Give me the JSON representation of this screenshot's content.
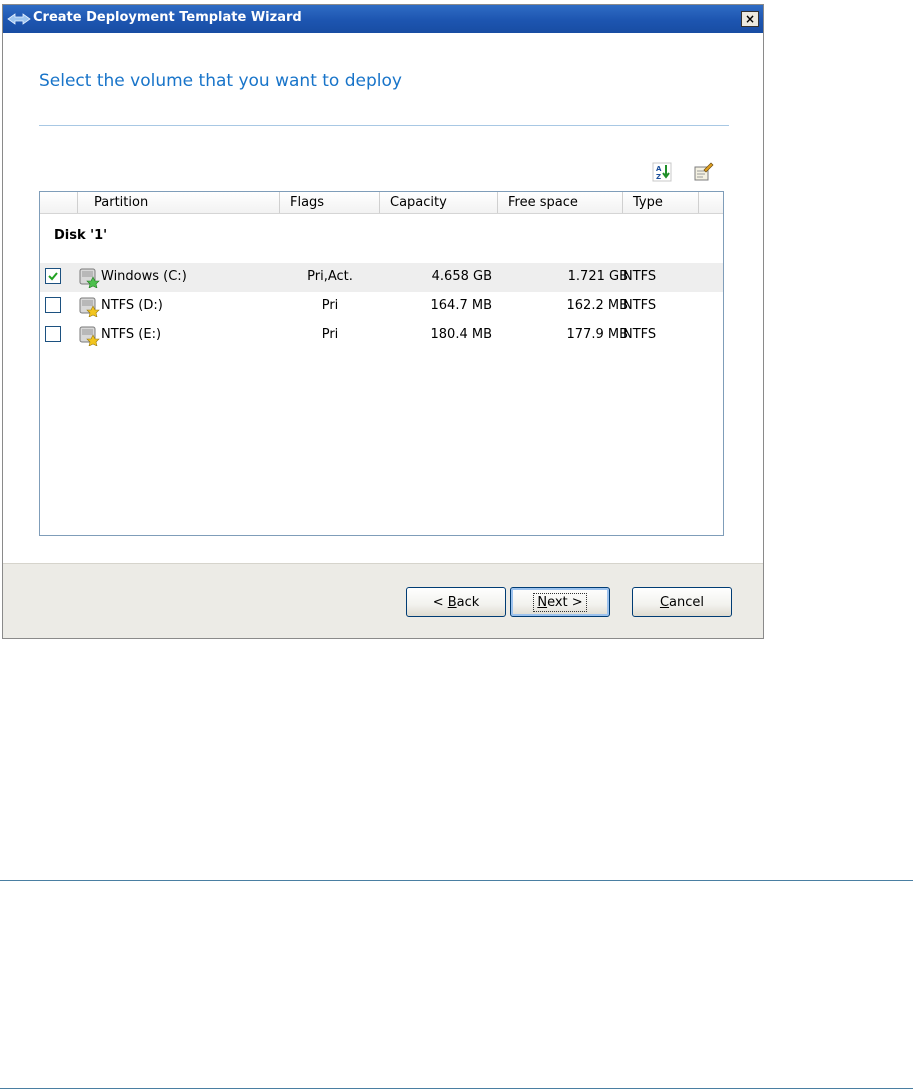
{
  "window": {
    "title": "Create Deployment Template Wizard",
    "close_label": "×"
  },
  "heading": "Select the volume that you want to deploy",
  "toolbar": {
    "sort_icon": "sort-az-icon",
    "properties_icon": "properties-icon"
  },
  "table": {
    "columns": [
      "Partition",
      "Flags",
      "Capacity",
      "Free space",
      "Type"
    ],
    "group_label": "Disk '1'",
    "rows": [
      {
        "checked": true,
        "partition": "Windows (C:)",
        "flags": "Pri,Act.",
        "capacity": "4.658 GB",
        "free_space": "1.721 GB",
        "type": "NTFS",
        "icon": "system-drive-icon"
      },
      {
        "checked": false,
        "partition": "NTFS (D:)",
        "flags": "Pri",
        "capacity": "164.7 MB",
        "free_space": "162.2 MB",
        "type": "NTFS",
        "icon": "drive-icon"
      },
      {
        "checked": false,
        "partition": "NTFS (E:)",
        "flags": "Pri",
        "capacity": "180.4 MB",
        "free_space": "177.9 MB",
        "type": "NTFS",
        "icon": "drive-icon"
      }
    ]
  },
  "buttons": {
    "back": {
      "prefix": "< ",
      "mnemonic": "B",
      "rest": "ack"
    },
    "next": {
      "prefix": "",
      "mnemonic": "N",
      "rest": "ext >"
    },
    "cancel": {
      "prefix": "",
      "mnemonic": "C",
      "rest": "ancel"
    }
  },
  "colors": {
    "title_bar": "#1d55b0",
    "heading": "#1874c9",
    "footer": "#ecebe6",
    "check_mark": "#21a121"
  }
}
